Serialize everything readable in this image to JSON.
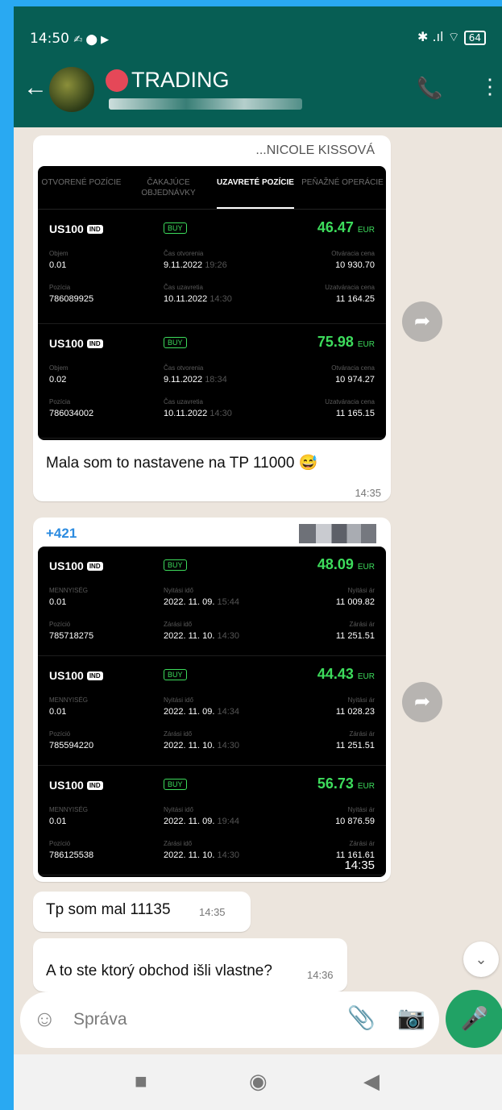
{
  "status_bar": {
    "time": "14:50",
    "icons_left": "✍ ⬤ ▶",
    "icons_right": "✱ .ıl ⌔",
    "battery": "64"
  },
  "chat": {
    "title": "TRADING"
  },
  "messages": [
    {
      "header_name": "...NICOLE KISSOVÁ",
      "tabs": [
        "OTVORENÉ POZÍCIE",
        "ČAKAJÚCE OBJEDNÁVKY",
        "UZAVRETÉ POZÍCIE",
        "PEŇAŽNÉ OPERÁCIE"
      ],
      "active_tab": 2,
      "positions": [
        {
          "symbol": "US100",
          "badge": "IND",
          "side": "BUY",
          "profit": "46.47",
          "currency": "EUR",
          "vol_label": "Objem",
          "vol": "0.01",
          "open_label": "Čas otvorenia",
          "open_date": "9.11.2022",
          "open_time": "19:26",
          "open_price_label": "Otváracia cena",
          "open_price": "10 930.70",
          "pos_label": "Pozícia",
          "pos_id": "786089925",
          "close_label": "Čas uzavretia",
          "close_date": "10.11.2022",
          "close_time": "14:30",
          "close_price_label": "Uzatváracia cena",
          "close_price": "11 164.25"
        },
        {
          "symbol": "US100",
          "badge": "IND",
          "side": "BUY",
          "profit": "75.98",
          "currency": "EUR",
          "vol_label": "Objem",
          "vol": "0.02",
          "open_label": "Čas otvorenia",
          "open_date": "9.11.2022",
          "open_time": "18:34",
          "open_price_label": "Otváracia cena",
          "open_price": "10 974.27",
          "pos_label": "Pozícia",
          "pos_id": "786034002",
          "close_label": "Čas uzavretia",
          "close_date": "10.11.2022",
          "close_time": "14:30",
          "close_price_label": "Uzatváracia cena",
          "close_price": "11 165.15"
        }
      ],
      "text": "Mala som to nastavene na TP 11000 😅",
      "time": "14:35"
    },
    {
      "sender": "+421",
      "positions": [
        {
          "symbol": "US100",
          "badge": "IND",
          "side": "BUY",
          "profit": "48.09",
          "currency": "EUR",
          "vol_label": "MENNYISÉG",
          "vol": "0.01",
          "open_label": "Nyitási idő",
          "open_date": "2022. 11. 09.",
          "open_time": "15:44",
          "open_price_label": "Nyitási ár",
          "open_price": "11 009.82",
          "pos_label": "Pozíció",
          "pos_id": "785718275",
          "close_label": "Zárási idő",
          "close_date": "2022. 11. 10.",
          "close_time": "14:30",
          "close_price_label": "Zárási ár",
          "close_price": "11 251.51"
        },
        {
          "symbol": "US100",
          "badge": "IND",
          "side": "BUY",
          "profit": "44.43",
          "currency": "EUR",
          "vol_label": "MENNYISÉG",
          "vol": "0.01",
          "open_label": "Nyitási idő",
          "open_date": "2022. 11. 09.",
          "open_time": "14:34",
          "open_price_label": "Nyitási ár",
          "open_price": "11 028.23",
          "pos_label": "Pozíció",
          "pos_id": "785594220",
          "close_label": "Zárási idő",
          "close_date": "2022. 11. 10.",
          "close_time": "14:30",
          "close_price_label": "Zárási ár",
          "close_price": "11 251.51"
        },
        {
          "symbol": "US100",
          "badge": "IND",
          "side": "BUY",
          "profit": "56.73",
          "currency": "EUR",
          "vol_label": "MENNYISÉG",
          "vol": "0.01",
          "open_label": "Nyitási idő",
          "open_date": "2022. 11. 09.",
          "open_time": "19:44",
          "open_price_label": "Nyitási ár",
          "open_price": "10 876.59",
          "pos_label": "Pozíció",
          "pos_id": "786125538",
          "close_label": "Zárási idő",
          "close_date": "2022. 11. 10.",
          "close_time": "14:30",
          "close_price_label": "Zárási ár",
          "close_price": "11 161.61"
        }
      ],
      "time": "14:35"
    },
    {
      "text": "Tp som mal 11135",
      "time": "14:35"
    },
    {
      "text": "A to ste ktorý obchod išli vlastne?",
      "time": "14:36"
    }
  ],
  "composer": {
    "placeholder": "Správa"
  },
  "icons": {
    "back": "←",
    "call": "📞",
    "menu": "⋮",
    "forward": "➦",
    "scroll_down": "⌄",
    "emoji": "☺",
    "attach": "📎",
    "camera": "📷",
    "mic": "🎤",
    "nav_square": "■",
    "nav_circle": "◉",
    "nav_back": "◀"
  },
  "colors": {
    "header": "#075e54",
    "chat_bg": "#ece5dd",
    "profit_green": "#3ddc5c",
    "mic_green": "#21a265"
  }
}
